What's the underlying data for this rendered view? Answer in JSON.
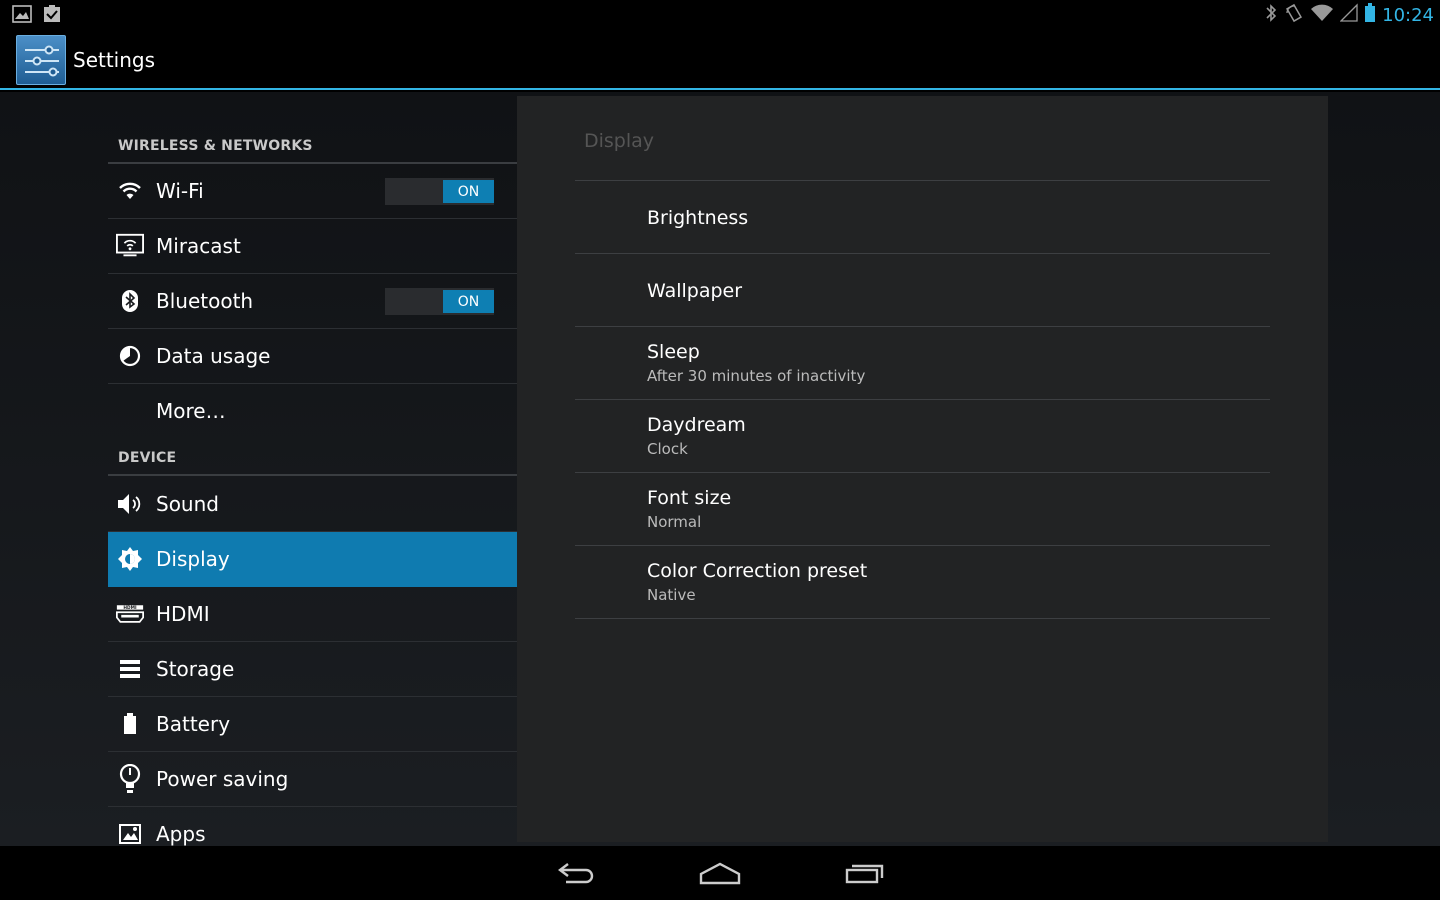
{
  "status_bar": {
    "time": "10:24",
    "left_icons": [
      "gallery-icon",
      "clipboard-check-icon"
    ],
    "right_icons": [
      "bluetooth-icon",
      "rotation-lock-icon",
      "wifi-icon",
      "signal-icon",
      "battery-icon"
    ]
  },
  "action_bar": {
    "title": "Settings",
    "icon": "settings-sliders-icon"
  },
  "sidebar": {
    "sections": [
      {
        "header": "WIRELESS & NETWORKS",
        "items": [
          {
            "label": "Wi-Fi",
            "icon": "wifi-icon",
            "toggle": "ON"
          },
          {
            "label": "Miracast",
            "icon": "miracast-icon"
          },
          {
            "label": "Bluetooth",
            "icon": "bluetooth-icon",
            "toggle": "ON"
          },
          {
            "label": "Data usage",
            "icon": "data-usage-icon"
          },
          {
            "label": "More…",
            "icon": ""
          }
        ]
      },
      {
        "header": "DEVICE",
        "items": [
          {
            "label": "Sound",
            "icon": "sound-icon"
          },
          {
            "label": "Display",
            "icon": "display-brightness-icon",
            "selected": true
          },
          {
            "label": "HDMI",
            "icon": "hdmi-icon"
          },
          {
            "label": "Storage",
            "icon": "storage-icon"
          },
          {
            "label": "Battery",
            "icon": "battery-icon"
          },
          {
            "label": "Power saving",
            "icon": "power-saving-icon"
          },
          {
            "label": "Apps",
            "icon": "apps-icon"
          }
        ]
      }
    ]
  },
  "detail": {
    "title": "Display",
    "prefs": [
      {
        "title": "Brightness",
        "summary": ""
      },
      {
        "title": "Wallpaper",
        "summary": ""
      },
      {
        "title": "Sleep",
        "summary": "After 30 minutes of inactivity"
      },
      {
        "title": "Daydream",
        "summary": "Clock"
      },
      {
        "title": "Font size",
        "summary": "Normal"
      },
      {
        "title": "Color Correction preset",
        "summary": "Native"
      }
    ]
  },
  "nav_bar": {
    "buttons": [
      "back-icon",
      "home-icon",
      "recents-icon"
    ]
  },
  "colors": {
    "accent": "#33b5e5",
    "selected": "#0f7bb0",
    "toggle_on": "#0e7fb3"
  }
}
